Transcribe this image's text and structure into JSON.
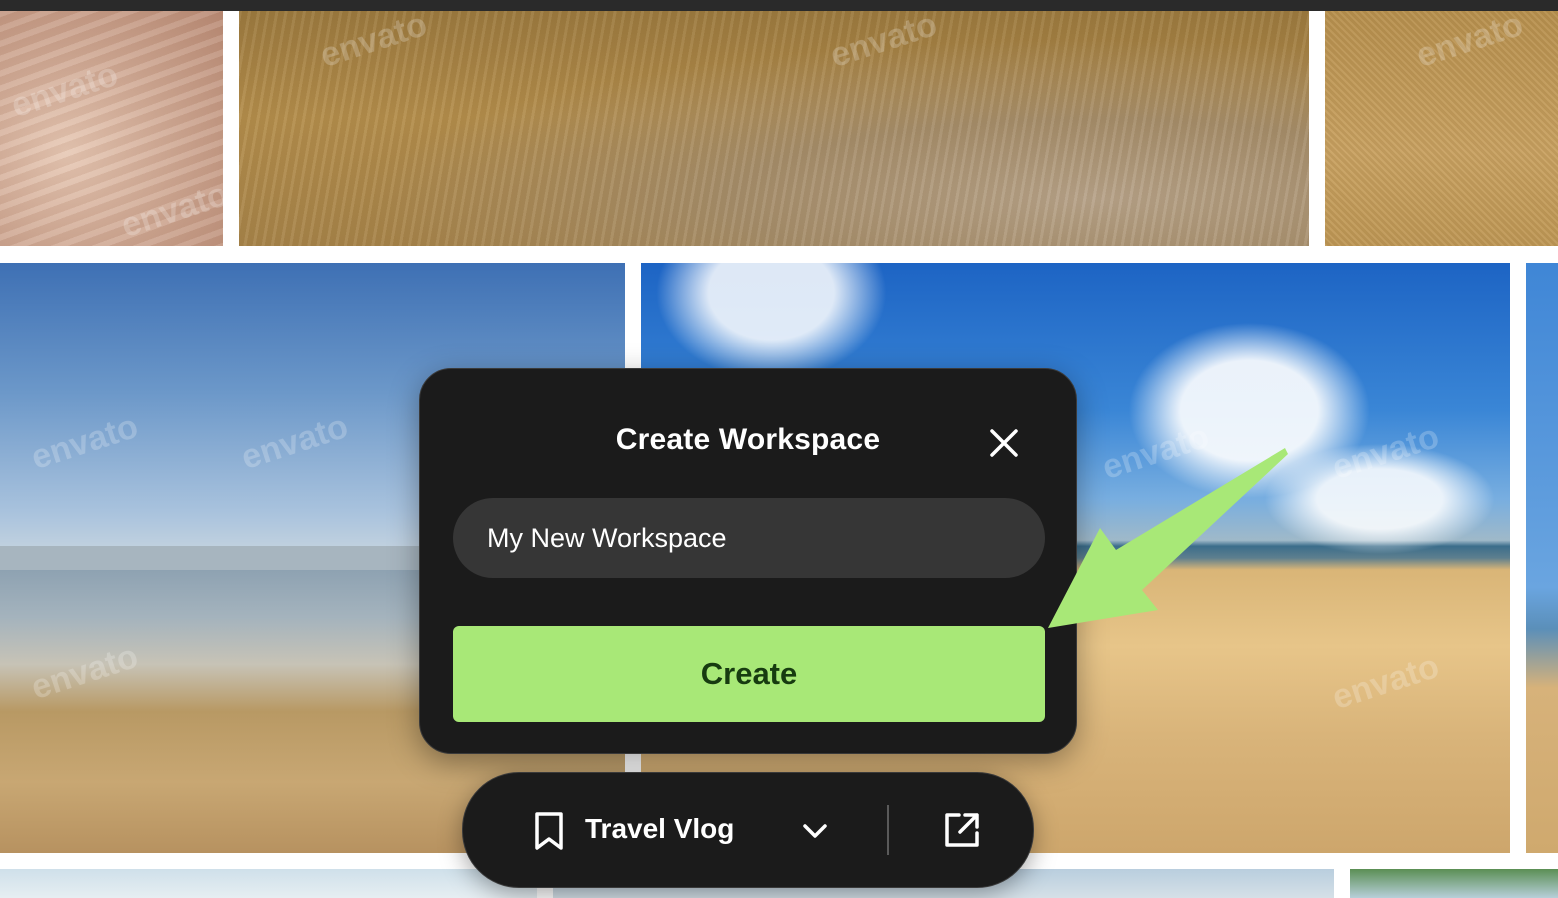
{
  "modal": {
    "title": "Create Workspace",
    "input_value": "My New Workspace",
    "create_label": "Create"
  },
  "workspace_bar": {
    "name": "Travel Vlog"
  },
  "watermark": "envato",
  "colors": {
    "modal_bg": "#1b1b1b",
    "input_bg": "#363636",
    "accent_green": "#a8e877",
    "arrow_green": "#a8e877"
  },
  "icons": {
    "close": "close-icon",
    "bookmark": "bookmark-icon",
    "chevron": "chevron-down-icon",
    "open": "open-external-icon"
  }
}
